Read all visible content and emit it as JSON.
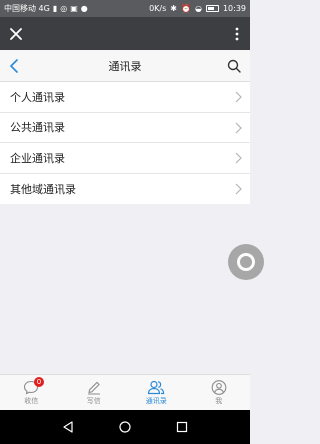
{
  "status_bar": {
    "carrier": "中国移动 4G",
    "speed": "0K/s",
    "time": "10:39"
  },
  "nav": {
    "title": "通讯录"
  },
  "contacts": {
    "items": [
      {
        "label": "个人通讯录"
      },
      {
        "label": "公共通讯录"
      },
      {
        "label": "企业通讯录"
      },
      {
        "label": "其他域通讯录"
      }
    ]
  },
  "tab_bar": {
    "tabs": [
      {
        "label": "收信",
        "icon": "chat-bubble-icon",
        "badge": "0"
      },
      {
        "label": "写信",
        "icon": "pencil-icon"
      },
      {
        "label": "通讯录",
        "icon": "contacts-icon",
        "active": true
      },
      {
        "label": "我",
        "icon": "user-icon"
      }
    ]
  },
  "colors": {
    "accent": "#2b8ad7",
    "badge": "#e02020",
    "app_bar": "#3d3e42",
    "status_bar": "#5a5b5e"
  }
}
